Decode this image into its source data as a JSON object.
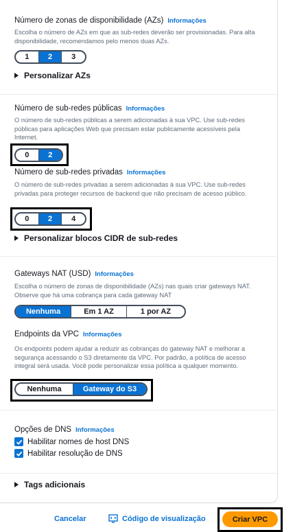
{
  "azs": {
    "label": "Número de zonas de disponibilidade (AZs)",
    "info": "Informações",
    "desc": "Escolha o número de AZs em que as sub-redes deverão ser provisionadas. Para alta disponibilidade, recomendamos pelo menos duas AZs.",
    "options": [
      "1",
      "2",
      "3"
    ],
    "selected": "2",
    "expander": "Personalizar AZs"
  },
  "public_subnets": {
    "label": "Número de sub-redes públicas",
    "info": "Informações",
    "desc": "O número de sub-redes públicas a serem adicionadas à sua VPC. Use sub-redes públicas para aplicações Web que precisam estar publicamente acessíveis pela Internet.",
    "options": [
      "0",
      "2"
    ],
    "selected": "2"
  },
  "private_subnets": {
    "label": "Número de sub-redes privadas",
    "info": "Informações",
    "desc": "O número de sub-redes privadas a serem adicionadas à sua VPC. Use sub-redes privadas para proteger recursos de backend que não precisam de acesso público.",
    "options": [
      "0",
      "2",
      "4"
    ],
    "selected": "2",
    "expander": "Personalizar blocos CIDR de sub-redes"
  },
  "nat": {
    "label": "Gateways NAT (USD)",
    "info": "Informações",
    "desc": "Escolha o número de zonas de disponibilidade (AZs) nas quais criar gateways NAT. Observe que há uma cobrança para cada gateway NAT",
    "options": [
      "Nenhuma",
      "Em 1 AZ",
      "1 por AZ"
    ],
    "selected": "Nenhuma"
  },
  "endpoints": {
    "label": "Endpoints da VPC",
    "info": "Informações",
    "desc": "Os endpoints podem ajudar a reduzir as cobranças do gateway NAT e melhorar a segurança acessando o S3 diretamente da VPC. Por padrão, a política de acesso integral será usada. Você pode personalizar essa política a qualquer momento.",
    "options": [
      "Nenhuma",
      "Gateway do S3"
    ],
    "selected": "Gateway do S3"
  },
  "dns": {
    "label": "Opções de DNS",
    "info": "Informações",
    "hostnames": "Habilitar nomes de host DNS",
    "resolution": "Habilitar resolução de DNS",
    "hostnames_checked": true,
    "resolution_checked": true
  },
  "tags": {
    "expander": "Tags adicionais"
  },
  "footer": {
    "cancel": "Cancelar",
    "preview": "Código de visualização",
    "create": "Criar VPC"
  },
  "colors": {
    "accent": "#0972d3",
    "primary": "#ff9900",
    "text": "#16191f",
    "muted": "#5f6b7a"
  },
  "icons": {
    "expander": "caret-right-icon",
    "check": "check-icon",
    "preview": "code-preview-icon"
  }
}
